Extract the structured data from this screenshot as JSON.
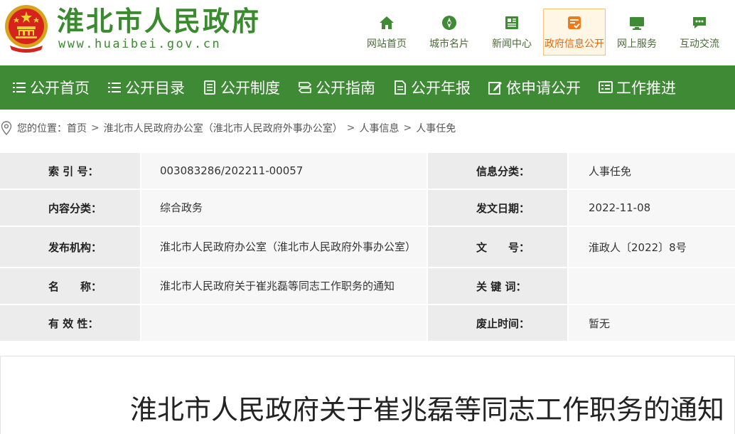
{
  "header": {
    "site_title": "淮北市人民政府",
    "site_url": "www.huaibei.gov.cn"
  },
  "topnav": [
    {
      "label": "网站首页",
      "icon": "home-icon"
    },
    {
      "label": "城市名片",
      "icon": "compass-icon"
    },
    {
      "label": "新闻中心",
      "icon": "newspaper-icon"
    },
    {
      "label": "政府信息公开",
      "icon": "document-check-icon",
      "active": true
    },
    {
      "label": "网上服务",
      "icon": "monitor-icon"
    },
    {
      "label": "互动交流",
      "icon": "chat-icon"
    }
  ],
  "mainnav": [
    {
      "label": "公开首页",
      "icon": "list-icon"
    },
    {
      "label": "公开目录",
      "icon": "list-icon"
    },
    {
      "label": "公开制度",
      "icon": "document-icon"
    },
    {
      "label": "公开指南",
      "icon": "signpost-icon"
    },
    {
      "label": "公开年报",
      "icon": "report-icon"
    },
    {
      "label": "依申请公开",
      "icon": "edit-icon"
    },
    {
      "label": "工作推进",
      "icon": "board-icon"
    }
  ],
  "breadcrumb": {
    "prefix": "您的位置：",
    "items": [
      "首页",
      "淮北市人民政府办公室（淮北市人民政府外事办公室）",
      "人事信息",
      "人事任免"
    ],
    "separator": ">"
  },
  "info": {
    "rows": [
      {
        "k1": "索 引 号：",
        "v1": "003083286/202211-00057",
        "k2": "信息分类：",
        "v2": "人事任免"
      },
      {
        "k1": "内容分类：",
        "v1": "综合政务",
        "k2": "发文日期：",
        "v2": "2022-11-08"
      },
      {
        "k1": "发布机构：",
        "v1": "淮北市人民政府办公室（淮北市人民政府外事办公室）",
        "k2": "文　　号：",
        "v2": "淮政人〔2022〕8号"
      },
      {
        "k1": "名　　称：",
        "v1": "淮北市人民政府关于崔兆磊等同志工作职务的通知",
        "k2": "关 键 词：",
        "v2": ""
      },
      {
        "k1": "有 效 性：",
        "v1": "",
        "k2": "废止时间：",
        "v2": "暂无"
      }
    ]
  },
  "article": {
    "title": "淮北市人民政府关于崔兆磊等同志工作职务的通知"
  },
  "colors": {
    "brand_green": "#3f8a35",
    "title_green": "#3a8a2e",
    "active_orange": "#e56a0b"
  }
}
